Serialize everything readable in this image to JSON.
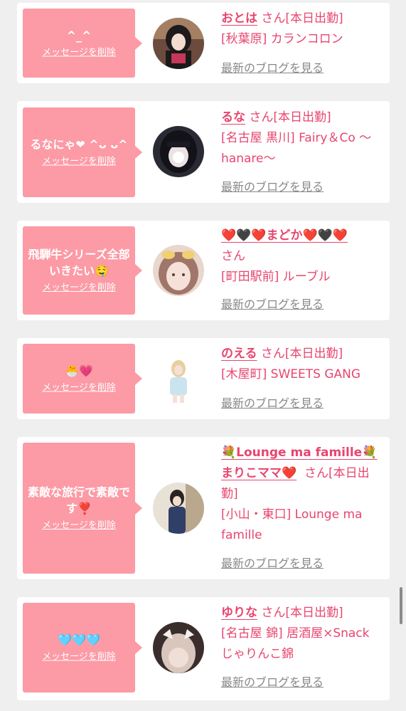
{
  "delete_label": "メッセージを削除",
  "blog_label": "最新のブログを見る",
  "cards": [
    {
      "message": "^_^",
      "name": "おとは",
      "suffix": "さん[本日出勤]",
      "location": "[秋葉原] カランコロン"
    },
    {
      "message": "るなにゃ❤︎ ^ᴗ ᴗ^",
      "name": "るな",
      "suffix": "さん[本日出勤]",
      "location": "[名古屋 黒川] Fairy＆Co 〜hanare〜"
    },
    {
      "message": "飛騨牛シリーズ全部いきたい🤤",
      "name": "❤️🖤❤️まどか❤️🖤❤️",
      "suffix": "さん",
      "location": "[町田駅前] ルーブル"
    },
    {
      "message": "🐣💗",
      "name": "のえる",
      "suffix": "さん[本日出勤]",
      "location": "[木屋町] SWEETS GANG"
    },
    {
      "message": "素敵な旅行で素敵です❣️",
      "name": "💐Lounge ma famille💐 まりこママ❤️",
      "suffix": "さん[本日出勤]",
      "location": "[小山・東口] Lounge ma famille"
    },
    {
      "message": "🩵🩵🩵",
      "name": "ゆりな",
      "suffix": "さん[本日出勤]",
      "location": "[名古屋 錦] 居酒屋×Snack じゃりんこ錦"
    }
  ]
}
